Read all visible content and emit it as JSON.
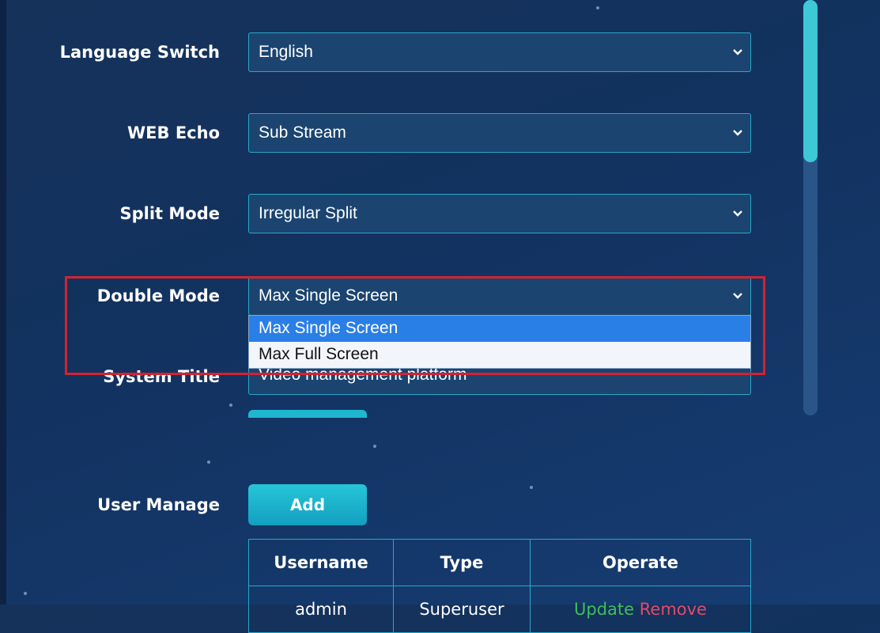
{
  "settings": {
    "language": {
      "label": "Language Switch",
      "value": "English"
    },
    "web_echo": {
      "label": "WEB Echo",
      "value": "Sub Stream"
    },
    "split_mode": {
      "label": "Split Mode",
      "value": "Irregular Split"
    },
    "double_mode": {
      "label": "Double Mode",
      "value": "Max Single Screen",
      "options": [
        "Max Single Screen",
        "Max Full Screen"
      ]
    },
    "system_title": {
      "label": "System Title",
      "value": "Video management platform"
    }
  },
  "user_manage": {
    "label": "User Manage",
    "add_label": "Add",
    "columns": [
      "Username",
      "Type",
      "Operate"
    ],
    "rows": [
      {
        "username": "admin",
        "type": "Superuser",
        "update": "Update",
        "remove": "Remove"
      }
    ]
  },
  "colors": {
    "accent": "#2aa7c9",
    "highlight": "#d3232e",
    "selected": "#2a7fe6"
  }
}
